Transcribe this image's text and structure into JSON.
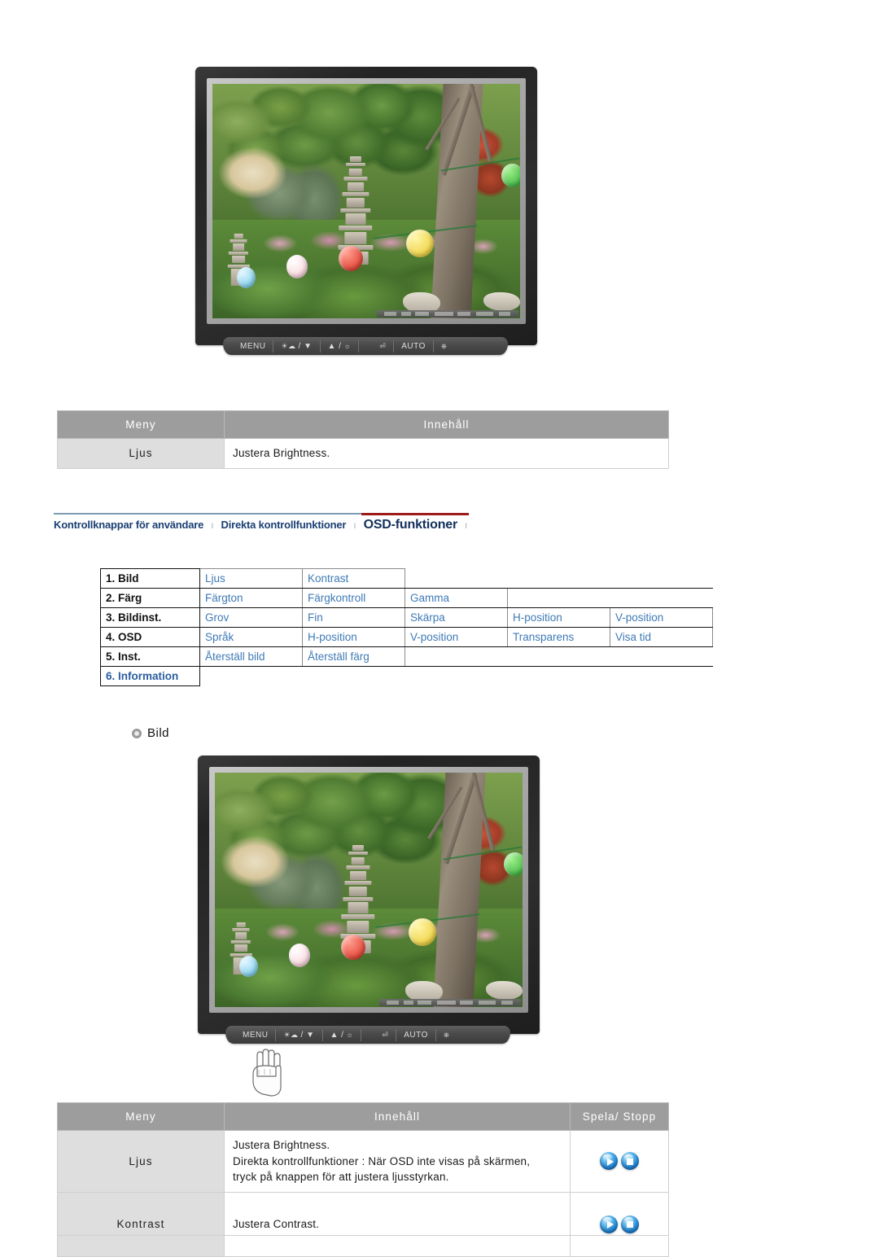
{
  "page": {
    "language": "sv"
  },
  "monitor_top": {
    "name": "monitor-illustration-top",
    "screen_image_description": "Tradgard med stenpagod, trad och kulorta lyktor",
    "buttons": [
      {
        "label": "MENU",
        "icon": ""
      },
      {
        "label": "",
        "icon": "▼",
        "prefix_icon": "brightness-dual-icon"
      },
      {
        "label": "",
        "icon": "▲",
        "suffix_icon": "brightness-sun-icon"
      },
      {
        "label": "",
        "icon": "enter-icon"
      },
      {
        "label": "AUTO",
        "icon": ""
      },
      {
        "label": "",
        "icon": "power-icon"
      }
    ],
    "button_texts": {
      "menu": "MENU",
      "down": "/ ▼",
      "up": "▲ /",
      "auto": "AUTO"
    }
  },
  "table_top": {
    "headers": [
      "Meny",
      "Innehåll"
    ],
    "rows": [
      {
        "meny": "Ljus",
        "content": "Justera Brightness."
      }
    ]
  },
  "navbar": {
    "items": [
      {
        "label": "Kontrollknappar för användare",
        "active": false
      },
      {
        "label": "Direkta kontrollfunktioner",
        "active": false
      },
      {
        "label": "OSD-funktioner",
        "active": true
      }
    ],
    "separator": "ı",
    "accent_color": "#9e1b1b",
    "rule_color": "#7d9bb0",
    "link_color": "#1a3f73"
  },
  "osd_grid": {
    "rows": [
      {
        "category": "1. Bild",
        "items": [
          "Ljus",
          "Kontrast"
        ]
      },
      {
        "category": "2. Färg",
        "items": [
          "Färgton",
          "Färgkontroll",
          "Gamma"
        ]
      },
      {
        "category": "3. Bildinst.",
        "items": [
          "Grov",
          "Fin",
          "Skärpa",
          "H-position",
          "V-position"
        ]
      },
      {
        "category": "4. OSD",
        "items": [
          "Språk",
          "H-position",
          "V-position",
          "Transparens",
          "Visa tid"
        ]
      },
      {
        "category": "5. Inst.",
        "items": [
          "Återställ bild",
          "Återställ färg"
        ]
      },
      {
        "category": "6. Information",
        "items": [],
        "category_is_link": true
      }
    ],
    "item_color": "#3f7ab5"
  },
  "section_heading": {
    "label": "Bild",
    "bullet_icon": "ring-bullet-icon"
  },
  "monitor_bottom": {
    "name": "monitor-illustration-bottom",
    "screen_image_description": "Tradgard med stenpagod, trad och kulorta lyktor",
    "button_texts": {
      "menu": "MENU",
      "down": "/ ▼",
      "up": "▲ /",
      "auto": "AUTO"
    },
    "hand_cursor_icon": "pointing-hand-icon"
  },
  "table_bottom": {
    "headers": [
      "Meny",
      "Innehåll",
      "Spela/ Stopp"
    ],
    "rows": [
      {
        "meny": "Ljus",
        "content_lines": [
          "Justera Brightness.",
          "Direkta kontrollfunktioner : När OSD inte visas på skärmen,",
          "tryck på knappen för att justera ljusstyrkan."
        ],
        "icons": [
          "play",
          "stop"
        ]
      },
      {
        "meny": "Kontrast",
        "content_lines": [
          "Justera Contrast."
        ],
        "icons": [
          "play",
          "stop"
        ]
      }
    ]
  }
}
